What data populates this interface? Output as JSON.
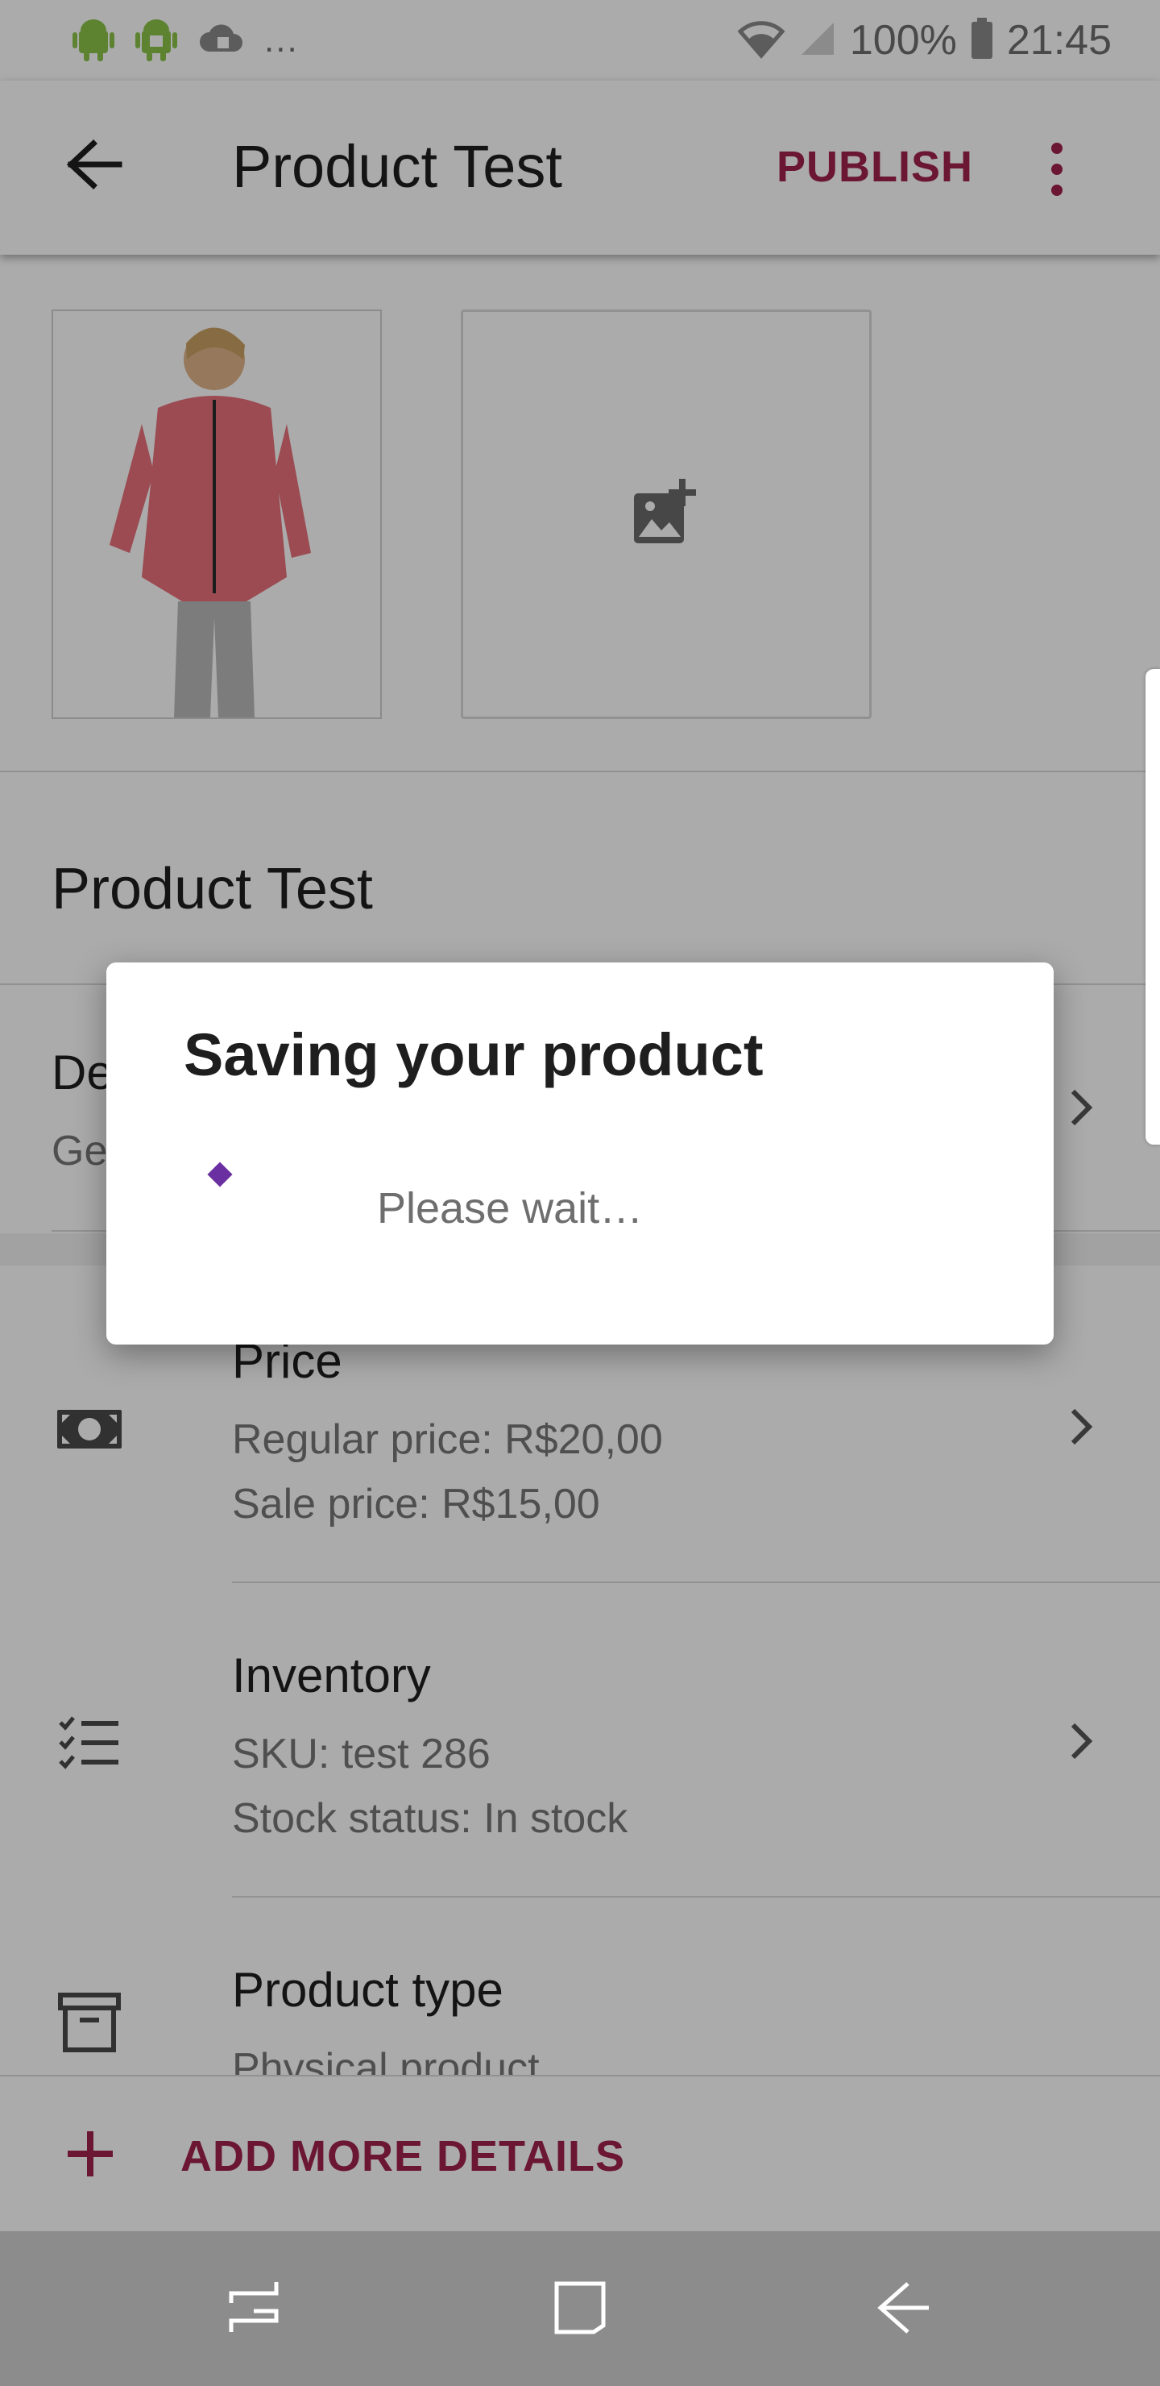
{
  "status_bar": {
    "overflow": "...",
    "battery": "100%",
    "time": "21:45"
  },
  "app_bar": {
    "title": "Product Test",
    "publish_label": "PUBLISH"
  },
  "product": {
    "name": "Product Test"
  },
  "rows": {
    "description": {
      "title": "De",
      "subtitle": "Ge"
    },
    "price": {
      "title": "Price",
      "line1": "Regular price: R$20,00",
      "line2": "Sale price: R$15,00"
    },
    "inventory": {
      "title": "Inventory",
      "line1": "SKU: test 286",
      "line2": "Stock status: In stock"
    },
    "product_type": {
      "title": "Product type",
      "line1": "Physical product"
    }
  },
  "add_details": {
    "label": "ADD MORE DETAILS"
  },
  "dialog": {
    "title": "Saving your product",
    "message": "Please wait…"
  },
  "colors": {
    "accent": "#a0214d",
    "spinner": "#6a2fa0",
    "scrim": "rgba(0,0,0,0.33)"
  },
  "icons": [
    "android-icon",
    "android-debug-icon",
    "cloud-sync-icon",
    "wifi-icon",
    "signal-icon",
    "battery-icon",
    "back-arrow-icon",
    "more-vert-icon",
    "add-photo-icon",
    "money-icon",
    "checklist-icon",
    "archive-icon",
    "chevron-right-icon",
    "plus-icon",
    "recents-icon",
    "home-icon",
    "nav-back-icon"
  ]
}
